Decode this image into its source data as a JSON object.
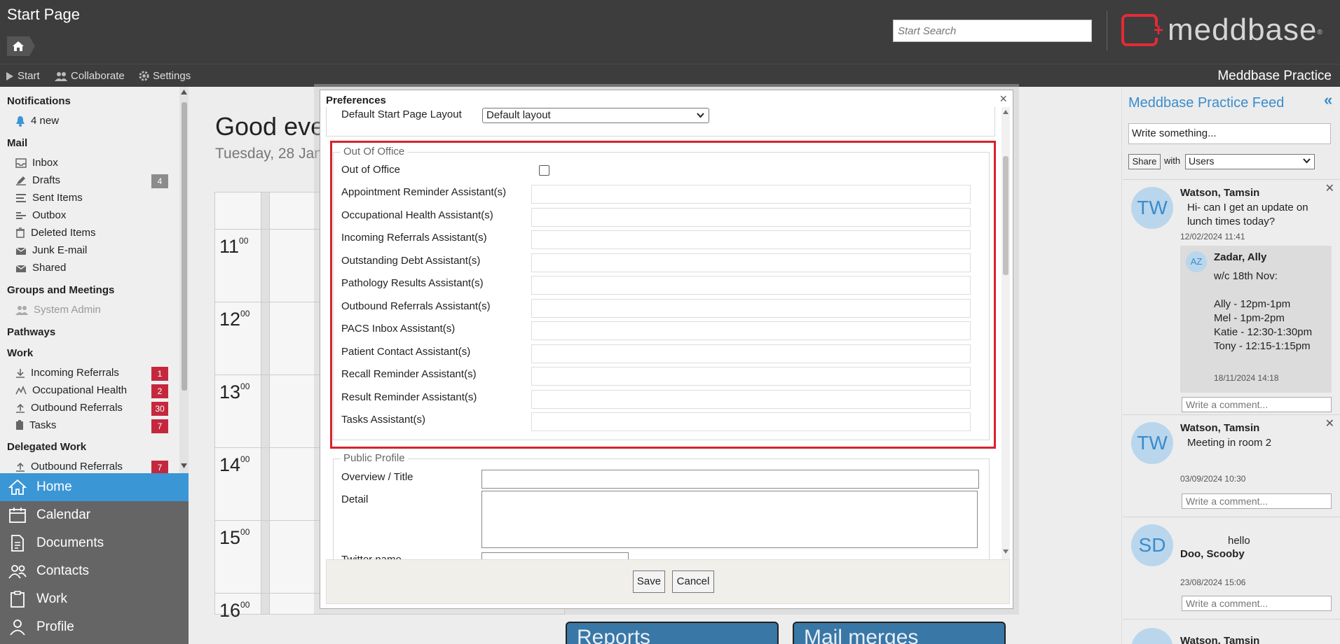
{
  "header": {
    "title": "Start Page",
    "search_placeholder": "Start Search",
    "logo_text": "meddbase",
    "logo_reg": "®",
    "app_name": "Meddbase Practice"
  },
  "menu": {
    "start": "Start",
    "collaborate": "Collaborate",
    "settings": "Settings"
  },
  "sidebar": {
    "notifications": {
      "heading": "Notifications",
      "new": "4 new"
    },
    "mail": {
      "heading": "Mail",
      "items": [
        {
          "label": "Inbox",
          "icon": "inbox-icon"
        },
        {
          "label": "Drafts",
          "badge": "4",
          "icon": "drafts-icon"
        },
        {
          "label": "Sent Items",
          "icon": "sent-icon"
        },
        {
          "label": "Outbox",
          "icon": "outbox-icon"
        },
        {
          "label": "Deleted Items",
          "icon": "trash-icon"
        },
        {
          "label": "Junk E-mail",
          "icon": "junk-icon"
        },
        {
          "label": "Shared",
          "icon": "shared-icon"
        }
      ]
    },
    "groups": {
      "heading": "Groups and Meetings",
      "items": [
        {
          "label": "System Admin"
        }
      ]
    },
    "pathways": {
      "heading": "Pathways"
    },
    "work": {
      "heading": "Work",
      "items": [
        {
          "label": "Incoming Referrals",
          "badge": "1"
        },
        {
          "label": "Occupational Health",
          "badge": "2"
        },
        {
          "label": "Outbound Referrals",
          "badge": "30"
        },
        {
          "label": "Tasks",
          "badge": "7"
        }
      ]
    },
    "delegated": {
      "heading": "Delegated Work",
      "items": [
        {
          "label": "Outbound Referrals",
          "badge": "7"
        }
      ]
    }
  },
  "nav": [
    {
      "label": "Home",
      "icon": "home-icon"
    },
    {
      "label": "Calendar",
      "icon": "calendar-icon"
    },
    {
      "label": "Documents",
      "icon": "documents-icon"
    },
    {
      "label": "Contacts",
      "icon": "contacts-icon"
    },
    {
      "label": "Work",
      "icon": "clipboard-icon"
    },
    {
      "label": "Profile",
      "icon": "profile-icon"
    }
  ],
  "main": {
    "greeting": "Good eve",
    "date": "Tuesday, 28 Jan",
    "hours": [
      {
        "h": "11",
        "m": "00"
      },
      {
        "h": "12",
        "m": "00"
      },
      {
        "h": "13",
        "m": "00"
      },
      {
        "h": "14",
        "m": "00"
      },
      {
        "h": "15",
        "m": "00"
      },
      {
        "h": "16",
        "m": "00"
      }
    ],
    "tiles": {
      "reports": "Reports",
      "mail_merges": "Mail merges"
    }
  },
  "dialog": {
    "title": "Preferences",
    "close": "×",
    "layout": {
      "label": "Default Start Page Layout",
      "value": "Default layout"
    },
    "out_of_office": {
      "legend": "Out Of Office",
      "checkbox_label": "Out of Office",
      "checked": false,
      "fields": [
        "Appointment Reminder Assistant(s)",
        "Occupational Health Assistant(s)",
        "Incoming Referrals Assistant(s)",
        "Outstanding Debt Assistant(s)",
        "Pathology Results Assistant(s)",
        "Outbound Referrals Assistant(s)",
        "PACS Inbox Assistant(s)",
        "Patient Contact Assistant(s)",
        "Recall Reminder Assistant(s)",
        "Result Reminder Assistant(s)",
        "Tasks Assistant(s)"
      ]
    },
    "public_profile": {
      "legend": "Public Profile",
      "overview": "Overview / Title",
      "detail": "Detail",
      "twitter": "Twitter name"
    },
    "save": "Save",
    "cancel": "Cancel"
  },
  "feed": {
    "title": "Meddbase Practice Feed",
    "collapse": "«",
    "input_placeholder": "Write something...",
    "share": "Share",
    "with": "with",
    "audience": "Users",
    "comment_placeholder": "Write a comment...",
    "posts": [
      {
        "initials": "TW",
        "author": "Watson, Tamsin",
        "text1": "Hi- can I get an update on",
        "text2": "lunch times today?",
        "time": "12/02/2024 11:41",
        "reply": {
          "initials": "AZ",
          "author": "Zadar, Ally",
          "lines": [
            "w/c 18th Nov:",
            "",
            "Ally - 12pm-1pm",
            "Mel - 1pm-2pm",
            "Katie - 12:30-1:30pm",
            "Tony - 12:15-1:15pm"
          ],
          "time": "18/11/2024 14:18"
        }
      },
      {
        "initials": "TW",
        "author": "Watson, Tamsin",
        "text1": "Meeting in room 2",
        "time": "03/09/2024 10:30"
      },
      {
        "initials": "SD",
        "author": "Doo, Scooby",
        "text1": "hello",
        "time": "23/08/2024 15:06"
      },
      {
        "author": "Watson, Tamsin"
      }
    ]
  },
  "colors": {
    "accent": "#3b96d6",
    "badge": "#c5283d",
    "highlight": "#d6232f",
    "brand": "#e32b37"
  }
}
